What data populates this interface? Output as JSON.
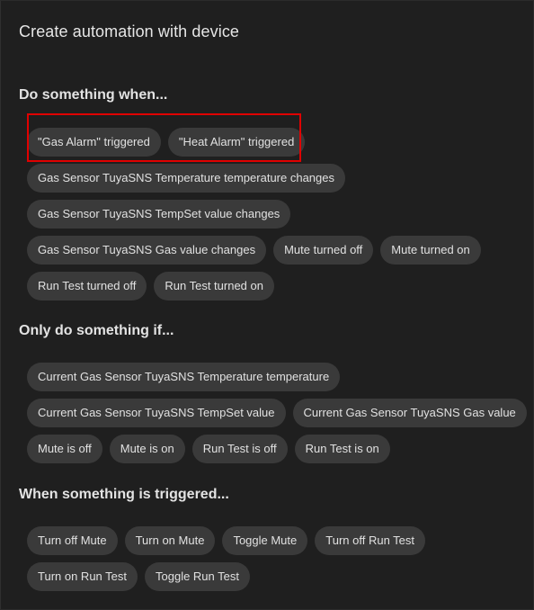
{
  "dialog": {
    "title": "Create automation with device"
  },
  "triggers": {
    "heading": "Do something when...",
    "rows": [
      [
        "\"Gas Alarm\" triggered",
        "\"Heat Alarm\" triggered"
      ],
      [
        "Gas Sensor TuyaSNS Temperature temperature changes"
      ],
      [
        "Gas Sensor TuyaSNS TempSet value changes"
      ],
      [
        "Gas Sensor TuyaSNS Gas value changes",
        "Mute turned off",
        "Mute turned on"
      ],
      [
        "Run Test turned off",
        "Run Test turned on"
      ]
    ]
  },
  "conditions": {
    "heading": "Only do something if...",
    "rows": [
      [
        "Current Gas Sensor TuyaSNS Temperature temperature"
      ],
      [
        "Current Gas Sensor TuyaSNS TempSet value",
        "Current Gas Sensor TuyaSNS Gas value"
      ],
      [
        "Mute is off",
        "Mute is on",
        "Run Test is off",
        "Run Test is on"
      ]
    ]
  },
  "actions": {
    "heading": "When something is triggered...",
    "rows": [
      [
        "Turn off Mute",
        "Turn on Mute",
        "Toggle Mute",
        "Turn off Run Test"
      ],
      [
        "Turn on Run Test",
        "Toggle Run Test"
      ]
    ]
  },
  "colors": {
    "background": "#1f1f1f",
    "chip": "#3a3a3a",
    "highlight": "#e00000",
    "text": "#e1e1e1"
  }
}
